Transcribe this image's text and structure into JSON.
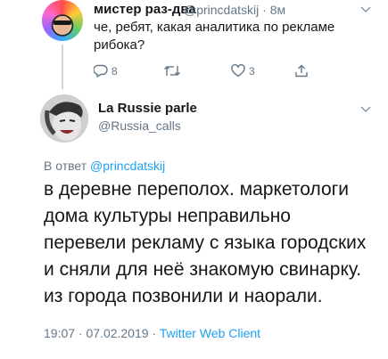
{
  "parent_tweet": {
    "display_name": "мистер раз-два",
    "handle": "@princdatskij",
    "time": "8м",
    "text": "че, ребят, какая аналитика по рекламе рибока?",
    "replies_count": "8",
    "likes_count": "3"
  },
  "main_tweet": {
    "display_name": "La Russie parle",
    "handle": "@Russia_calls",
    "reply_prefix": "В ответ ",
    "reply_to": "@princdatskij",
    "lines": [
      "в деревне переполох. маркетологи",
      "дома культуры неправильно",
      "перевели рекламу с языка городских",
      "и сняли для неё знакомую свинарку.",
      "из города позвонили и наорали."
    ],
    "timestamp": "19:07 · 07.02.2019 · ",
    "client": "Twitter Web Client"
  },
  "colors": {
    "text": "#14171a",
    "secondary": "#657786",
    "link": "#1da1f2",
    "thread_line": "#ccd6dd"
  },
  "icons": [
    "reply-icon",
    "retweet-icon",
    "like-icon",
    "share-icon",
    "chevron-down-icon"
  ]
}
